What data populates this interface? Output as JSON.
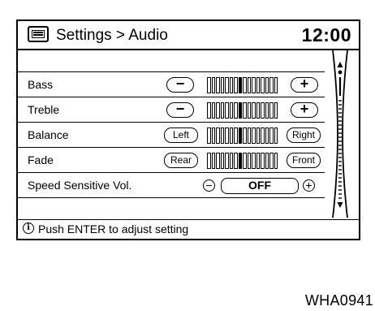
{
  "header": {
    "title": "Settings > Audio",
    "clock": "12:00",
    "icon": "settings-screen-icon"
  },
  "rows": [
    {
      "label": "Bass",
      "left": "−",
      "right": "+",
      "level": 0.5
    },
    {
      "label": "Treble",
      "left": "−",
      "right": "+",
      "level": 0.5
    },
    {
      "label": "Balance",
      "left": "Left",
      "right": "Right",
      "level": 0.5
    },
    {
      "label": "Fade",
      "left": "Rear",
      "right": "Front",
      "level": 0.5
    },
    {
      "label": "Speed Sensitive Vol.",
      "minus": "−",
      "value": "OFF",
      "plus": "+"
    }
  ],
  "status": {
    "icon": "info-icon",
    "text": "Push ENTER to adjust setting"
  },
  "figure_code": "WHA0941"
}
